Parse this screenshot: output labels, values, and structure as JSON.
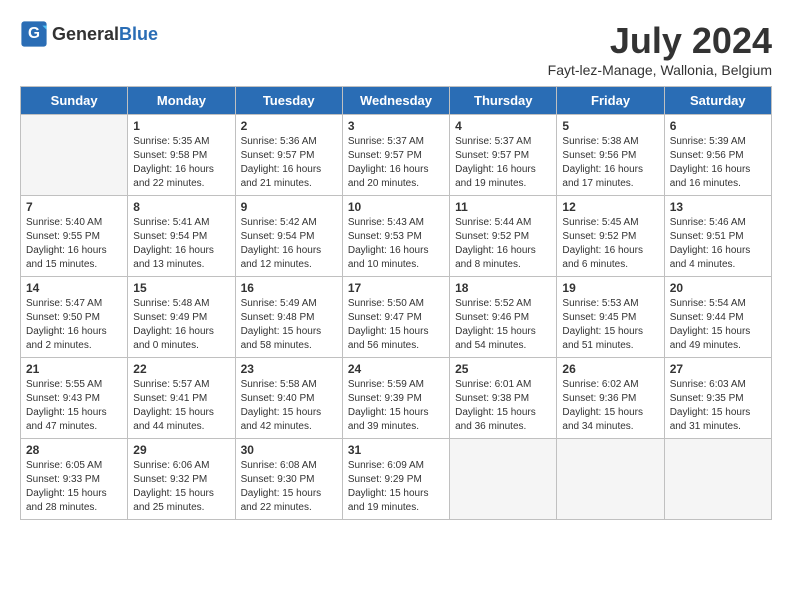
{
  "app": {
    "name_general": "General",
    "name_blue": "Blue"
  },
  "calendar": {
    "title": "July 2024",
    "subtitle": "Fayt-lez-Manage, Wallonia, Belgium"
  },
  "days_of_week": [
    "Sunday",
    "Monday",
    "Tuesday",
    "Wednesday",
    "Thursday",
    "Friday",
    "Saturday"
  ],
  "weeks": [
    [
      {
        "day": "",
        "info": ""
      },
      {
        "day": "1",
        "info": "Sunrise: 5:35 AM\nSunset: 9:58 PM\nDaylight: 16 hours\nand 22 minutes."
      },
      {
        "day": "2",
        "info": "Sunrise: 5:36 AM\nSunset: 9:57 PM\nDaylight: 16 hours\nand 21 minutes."
      },
      {
        "day": "3",
        "info": "Sunrise: 5:37 AM\nSunset: 9:57 PM\nDaylight: 16 hours\nand 20 minutes."
      },
      {
        "day": "4",
        "info": "Sunrise: 5:37 AM\nSunset: 9:57 PM\nDaylight: 16 hours\nand 19 minutes."
      },
      {
        "day": "5",
        "info": "Sunrise: 5:38 AM\nSunset: 9:56 PM\nDaylight: 16 hours\nand 17 minutes."
      },
      {
        "day": "6",
        "info": "Sunrise: 5:39 AM\nSunset: 9:56 PM\nDaylight: 16 hours\nand 16 minutes."
      }
    ],
    [
      {
        "day": "7",
        "info": "Sunrise: 5:40 AM\nSunset: 9:55 PM\nDaylight: 16 hours\nand 15 minutes."
      },
      {
        "day": "8",
        "info": "Sunrise: 5:41 AM\nSunset: 9:54 PM\nDaylight: 16 hours\nand 13 minutes."
      },
      {
        "day": "9",
        "info": "Sunrise: 5:42 AM\nSunset: 9:54 PM\nDaylight: 16 hours\nand 12 minutes."
      },
      {
        "day": "10",
        "info": "Sunrise: 5:43 AM\nSunset: 9:53 PM\nDaylight: 16 hours\nand 10 minutes."
      },
      {
        "day": "11",
        "info": "Sunrise: 5:44 AM\nSunset: 9:52 PM\nDaylight: 16 hours\nand 8 minutes."
      },
      {
        "day": "12",
        "info": "Sunrise: 5:45 AM\nSunset: 9:52 PM\nDaylight: 16 hours\nand 6 minutes."
      },
      {
        "day": "13",
        "info": "Sunrise: 5:46 AM\nSunset: 9:51 PM\nDaylight: 16 hours\nand 4 minutes."
      }
    ],
    [
      {
        "day": "14",
        "info": "Sunrise: 5:47 AM\nSunset: 9:50 PM\nDaylight: 16 hours\nand 2 minutes."
      },
      {
        "day": "15",
        "info": "Sunrise: 5:48 AM\nSunset: 9:49 PM\nDaylight: 16 hours\nand 0 minutes."
      },
      {
        "day": "16",
        "info": "Sunrise: 5:49 AM\nSunset: 9:48 PM\nDaylight: 15 hours\nand 58 minutes."
      },
      {
        "day": "17",
        "info": "Sunrise: 5:50 AM\nSunset: 9:47 PM\nDaylight: 15 hours\nand 56 minutes."
      },
      {
        "day": "18",
        "info": "Sunrise: 5:52 AM\nSunset: 9:46 PM\nDaylight: 15 hours\nand 54 minutes."
      },
      {
        "day": "19",
        "info": "Sunrise: 5:53 AM\nSunset: 9:45 PM\nDaylight: 15 hours\nand 51 minutes."
      },
      {
        "day": "20",
        "info": "Sunrise: 5:54 AM\nSunset: 9:44 PM\nDaylight: 15 hours\nand 49 minutes."
      }
    ],
    [
      {
        "day": "21",
        "info": "Sunrise: 5:55 AM\nSunset: 9:43 PM\nDaylight: 15 hours\nand 47 minutes."
      },
      {
        "day": "22",
        "info": "Sunrise: 5:57 AM\nSunset: 9:41 PM\nDaylight: 15 hours\nand 44 minutes."
      },
      {
        "day": "23",
        "info": "Sunrise: 5:58 AM\nSunset: 9:40 PM\nDaylight: 15 hours\nand 42 minutes."
      },
      {
        "day": "24",
        "info": "Sunrise: 5:59 AM\nSunset: 9:39 PM\nDaylight: 15 hours\nand 39 minutes."
      },
      {
        "day": "25",
        "info": "Sunrise: 6:01 AM\nSunset: 9:38 PM\nDaylight: 15 hours\nand 36 minutes."
      },
      {
        "day": "26",
        "info": "Sunrise: 6:02 AM\nSunset: 9:36 PM\nDaylight: 15 hours\nand 34 minutes."
      },
      {
        "day": "27",
        "info": "Sunrise: 6:03 AM\nSunset: 9:35 PM\nDaylight: 15 hours\nand 31 minutes."
      }
    ],
    [
      {
        "day": "28",
        "info": "Sunrise: 6:05 AM\nSunset: 9:33 PM\nDaylight: 15 hours\nand 28 minutes."
      },
      {
        "day": "29",
        "info": "Sunrise: 6:06 AM\nSunset: 9:32 PM\nDaylight: 15 hours\nand 25 minutes."
      },
      {
        "day": "30",
        "info": "Sunrise: 6:08 AM\nSunset: 9:30 PM\nDaylight: 15 hours\nand 22 minutes."
      },
      {
        "day": "31",
        "info": "Sunrise: 6:09 AM\nSunset: 9:29 PM\nDaylight: 15 hours\nand 19 minutes."
      },
      {
        "day": "",
        "info": ""
      },
      {
        "day": "",
        "info": ""
      },
      {
        "day": "",
        "info": ""
      }
    ]
  ]
}
